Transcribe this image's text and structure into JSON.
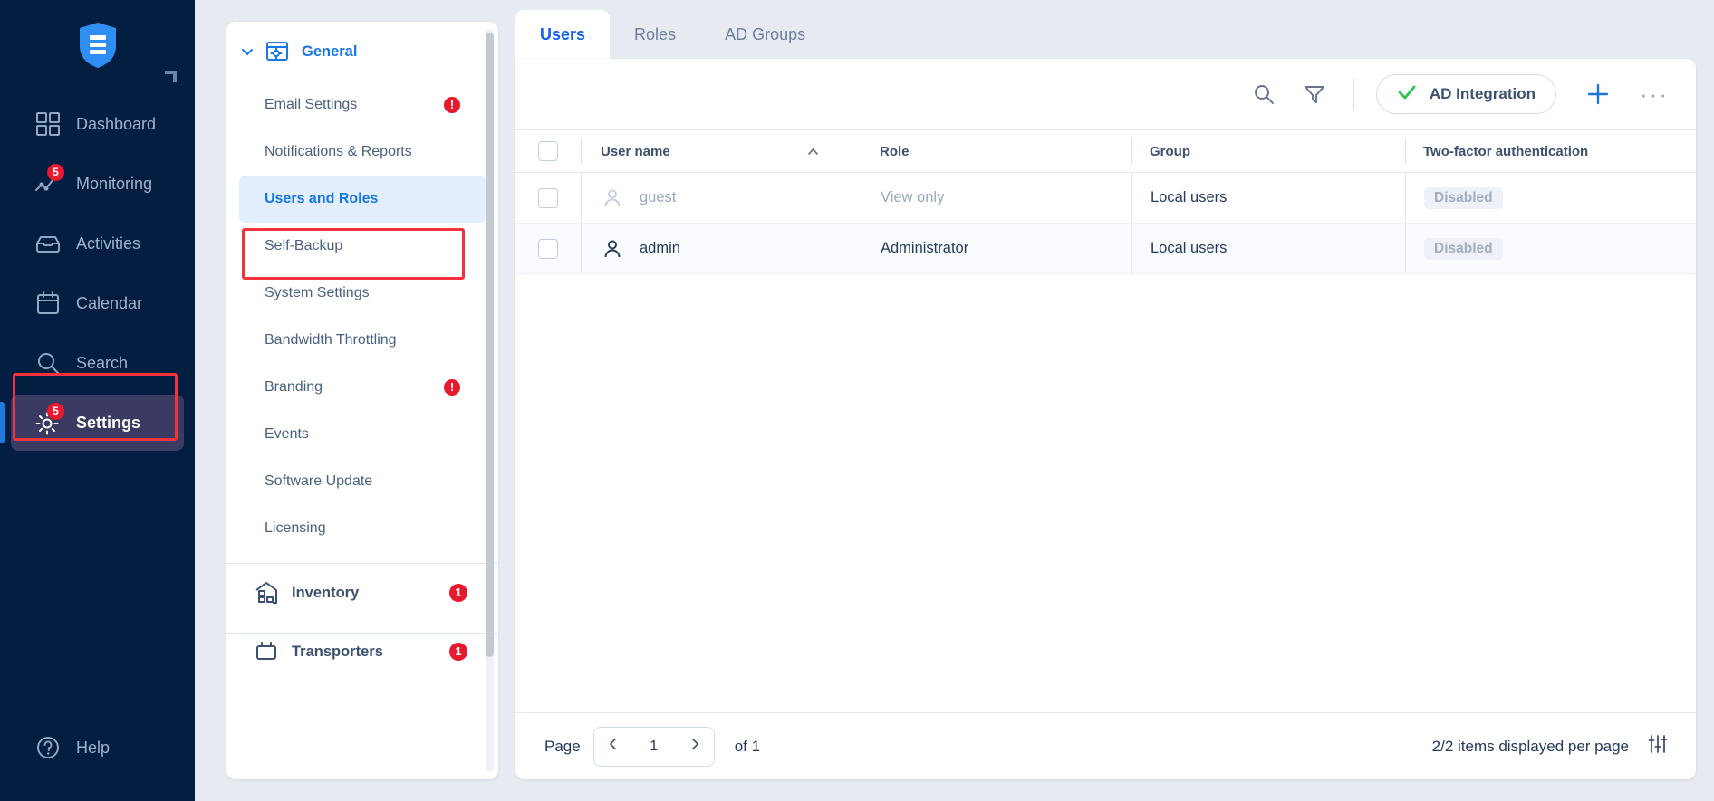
{
  "colors": {
    "nav_bg": "#041e42",
    "accent_blue": "#1677e8",
    "highlight_red": "#f4323c",
    "badge_red": "#e8192c",
    "green_check": "#2fc14a",
    "page_bg": "#e8eaf1"
  },
  "leftnav": {
    "logo_name": "shield-logo",
    "items": [
      {
        "label": "Dashboard",
        "icon": "dashboard-icon",
        "badge": null,
        "active": false
      },
      {
        "label": "Monitoring",
        "icon": "monitoring-icon",
        "badge": "5",
        "active": false
      },
      {
        "label": "Activities",
        "icon": "activities-icon",
        "badge": null,
        "active": false
      },
      {
        "label": "Calendar",
        "icon": "calendar-icon",
        "badge": null,
        "active": false
      },
      {
        "label": "Search",
        "icon": "search-icon",
        "badge": null,
        "active": false
      },
      {
        "label": "Settings",
        "icon": "gear-icon",
        "badge": "5",
        "active": true
      }
    ],
    "help": {
      "label": "Help",
      "icon": "help-icon"
    }
  },
  "settings_panel": {
    "group": {
      "label": "General",
      "icon": "general-settings-icon",
      "expanded": true
    },
    "items": [
      {
        "label": "Email Settings",
        "warning": "!",
        "selected": false
      },
      {
        "label": "Notifications & Reports",
        "warning": null,
        "selected": false
      },
      {
        "label": "Users and Roles",
        "warning": null,
        "selected": true
      },
      {
        "label": "Self-Backup",
        "warning": null,
        "selected": false
      },
      {
        "label": "System Settings",
        "warning": null,
        "selected": false
      },
      {
        "label": "Bandwidth Throttling",
        "warning": null,
        "selected": false
      },
      {
        "label": "Branding",
        "warning": "!",
        "selected": false
      },
      {
        "label": "Events",
        "warning": null,
        "selected": false
      },
      {
        "label": "Software Update",
        "warning": null,
        "selected": false
      },
      {
        "label": "Licensing",
        "warning": null,
        "selected": false
      }
    ],
    "sections": [
      {
        "label": "Inventory",
        "icon": "inventory-icon",
        "badge": "1"
      },
      {
        "label": "Transporters",
        "icon": "transporter-icon",
        "badge": "1"
      }
    ]
  },
  "tabs": [
    {
      "label": "Users",
      "active": true
    },
    {
      "label": "Roles",
      "active": false
    },
    {
      "label": "AD Groups",
      "active": false
    }
  ],
  "toolbar": {
    "search_icon": "search-icon",
    "filter_icon": "filter-icon",
    "ad_integration_label": "AD Integration",
    "ad_integration_icon": "check-icon",
    "add_icon": "plus-icon",
    "more_icon": "ellipsis-icon"
  },
  "table": {
    "columns": [
      "User name",
      "Role",
      "Group",
      "Two-factor authentication"
    ],
    "sort_column": "User name",
    "sort_direction": "asc",
    "rows": [
      {
        "user": "guest",
        "role": "View only",
        "group": "Local users",
        "twofa": "Disabled",
        "muted": true
      },
      {
        "user": "admin",
        "role": "Administrator",
        "group": "Local users",
        "twofa": "Disabled",
        "muted": false
      }
    ]
  },
  "footer": {
    "page_label": "Page",
    "page_value": "1",
    "of_label": "of 1",
    "prev_icon": "chevron-left-icon",
    "next_icon": "chevron-right-icon",
    "items_info": "2/2 items displayed per page",
    "settings_icon": "sliders-icon"
  }
}
